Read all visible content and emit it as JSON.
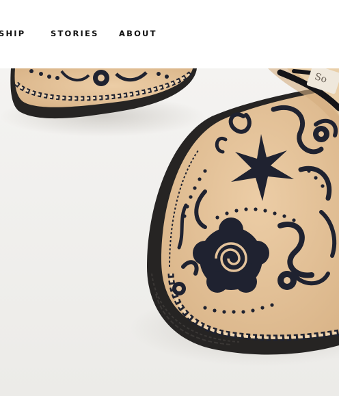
{
  "nav": {
    "items": [
      {
        "label": "SHIP"
      },
      {
        "label": "STORIES"
      },
      {
        "label": "ABOUT"
      }
    ]
  },
  "hero": {
    "image_alt": "Close-up of embroidered espadrille shoe",
    "label_text": "So"
  },
  "colors": {
    "background": "#f1f0ee",
    "canvas": "#e8c8a0",
    "embroidery": "#1f2230",
    "jute_sole": "#262423"
  }
}
